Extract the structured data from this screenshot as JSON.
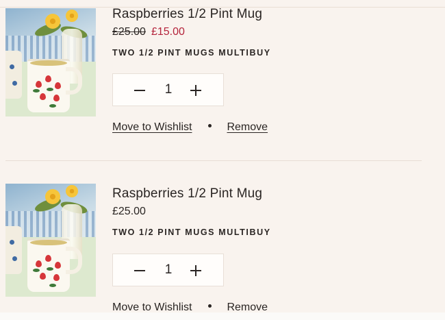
{
  "cart": {
    "items": [
      {
        "title": "Raspberries 1/2 Pint Mug",
        "price_original": "£25.00",
        "price_sale": "£15.00",
        "price": "",
        "promotion": "TWO 1/2 PINT MUGS MULTIBUY",
        "quantity": "1",
        "wishlist_label": "Move to Wishlist",
        "remove_label": "Remove"
      },
      {
        "title": "Raspberries 1/2 Pint Mug",
        "price_original": "",
        "price_sale": "",
        "price": "£25.00",
        "promotion": "TWO 1/2 PINT MUGS MULTIBUY",
        "quantity": "1",
        "wishlist_label": "Move to Wishlist",
        "remove_label": "Remove"
      }
    ]
  },
  "icons": {
    "decrease": "minus-icon",
    "increase": "plus-icon",
    "separator": "bullet-dot-icon"
  },
  "colors": {
    "background": "#f9f3ee",
    "text": "#2a2523",
    "sale_price": "#b4233b"
  }
}
